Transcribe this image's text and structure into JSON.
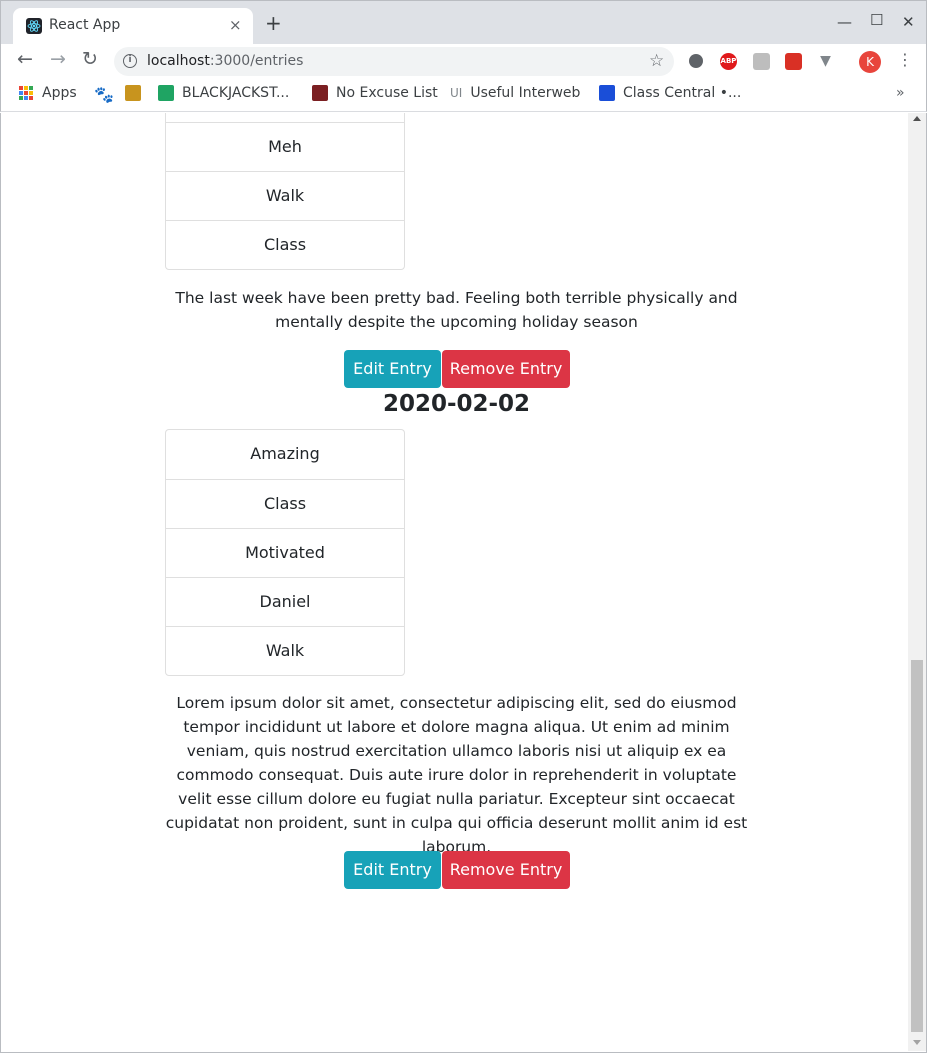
{
  "browser": {
    "tab_title": "React App",
    "tab_close": "×",
    "new_tab": "+",
    "url_host": "localhost",
    "url_path": ":3000/entries",
    "profile_initial": "K",
    "ext_abp": "ABP",
    "bookmarks": [
      {
        "label": "Apps"
      },
      {
        "label": ""
      },
      {
        "label": ""
      },
      {
        "label": "BLACKJACKST..."
      },
      {
        "label": "No Excuse List"
      },
      {
        "label": "Useful Interweb"
      },
      {
        "label": "Class Central •..."
      }
    ],
    "bookmarks_more": "»"
  },
  "entries": [
    {
      "items": [
        "Meh",
        "Walk",
        "Class"
      ],
      "text": "The last week have been pretty bad. Feeling both terrible physically and mentally despite the upcoming holiday season",
      "edit_label": "Edit Entry",
      "remove_label": "Remove Entry"
    },
    {
      "date": "2020-02-02",
      "items": [
        "Amazing",
        "Class",
        "Motivated",
        "Daniel",
        "Walk"
      ],
      "text": "Lorem ipsum dolor sit amet, consectetur adipiscing elit, sed do eiusmod tempor incididunt ut labore et dolore magna aliqua. Ut enim ad minim veniam, quis nostrud exercitation ullamco laboris nisi ut aliquip ex ea commodo consequat. Duis aute irure dolor in reprehenderit in voluptate velit esse cillum dolore eu fugiat nulla pariatur. Excepteur sint occaecat cupidatat non proident, sunt in culpa qui officia deserunt mollit anim id est laborum.",
      "edit_label": "Edit Entry",
      "remove_label": "Remove Entry"
    }
  ],
  "colors": {
    "edit_button": "#17a2b8",
    "remove_button": "#dc3545"
  }
}
